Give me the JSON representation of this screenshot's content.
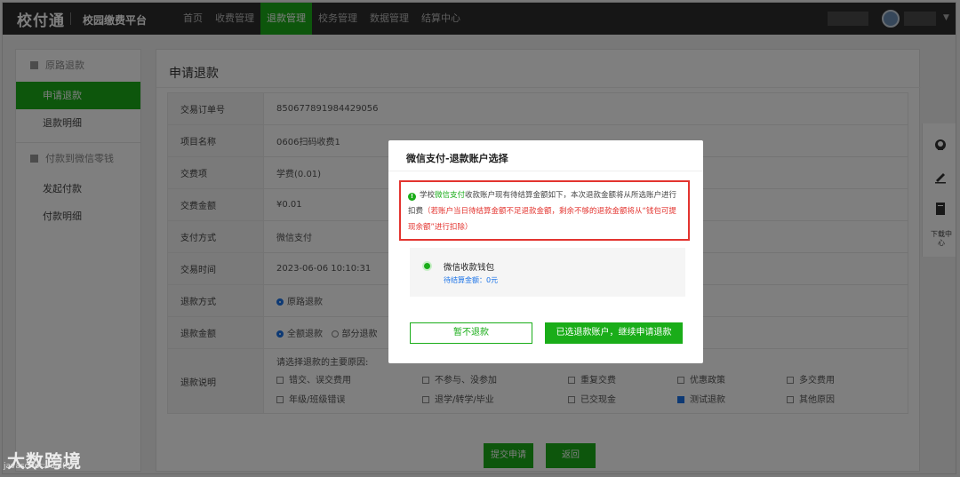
{
  "header": {
    "logo": "校付通",
    "platform": "校园缴费平台",
    "nav": [
      "首页",
      "收费管理",
      "退款管理",
      "校务管理",
      "数据管理",
      "结算中心"
    ],
    "active_nav_index": 2
  },
  "sidebar": {
    "group1": "原路退款",
    "group1_items": [
      "申请退款",
      "退款明细"
    ],
    "group2": "付款到微信零钱",
    "group2_items": [
      "发起付款",
      "付款明细"
    ]
  },
  "main": {
    "title": "申请退款",
    "rows": [
      {
        "label": "交易订单号",
        "value": "850677891984429056"
      },
      {
        "label": "项目名称",
        "value": "0606扫码收费1"
      },
      {
        "label": "交费项",
        "value": "学费(0.01)"
      },
      {
        "label": "交费金额",
        "value": "¥0.01"
      },
      {
        "label": "支付方式",
        "value": "微信支付"
      },
      {
        "label": "交易时间",
        "value": "2023-06-06 10:10:31"
      }
    ],
    "refund_method_label": "退款方式",
    "refund_method_option": "原路退款",
    "refund_amount_label": "退款金额",
    "refund_amount_options": [
      "全额退款",
      "部分退款"
    ],
    "refund_reason_label": "退款说明",
    "reason_heading": "请选择退款的主要原因:",
    "reasons": [
      "错交、误交费用",
      "不参与、没参加",
      "重复交费",
      "优惠政策",
      "多交费用",
      "年级/班级错误",
      "退学/转学/毕业",
      "已交现金",
      "测试退款",
      "其他原因"
    ],
    "reason_checked_index": 8,
    "submit_label": "提交申请",
    "back_label": "返回"
  },
  "rightrail": {
    "download_label": "下载中心"
  },
  "dialog": {
    "title": "微信支付-退款账户选择",
    "notice_prefix": "学校",
    "notice_link": "微信支付",
    "notice_body": "收款账户现有待结算金额如下，本次退款金额将从所选账户进行扣费",
    "notice_red": "（若账户当日待结算金额不足退款金额，剩余不够的退款金额将从“钱包可提现余额”进行扣除）",
    "account_name": "微信收款钱包",
    "account_balance": "待结算金额：0元",
    "cancel_label": "暂不退款",
    "confirm_label": "已选退款账户，继续申请退款"
  },
  "watermark": "大数跨境",
  "statusbar": "javascript:void(0)"
}
